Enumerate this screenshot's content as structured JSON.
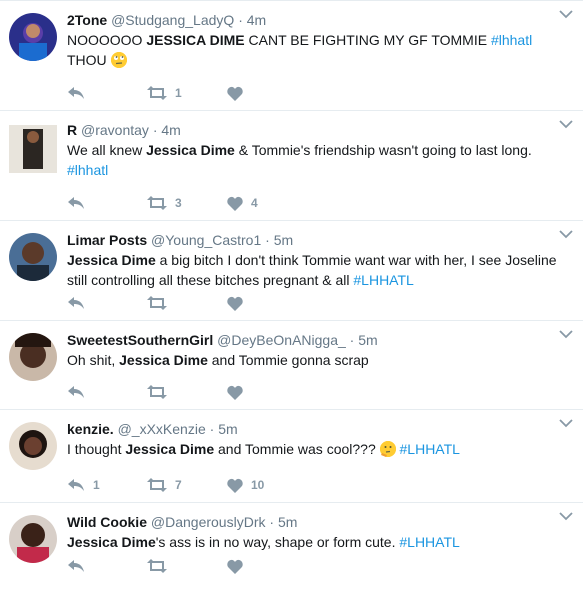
{
  "colors": {
    "link": "#1b95e0",
    "muted": "#657786",
    "action": "#8899a6",
    "divider": "#e6ecf0"
  },
  "icons": {
    "reply": "reply-icon",
    "retweet": "retweet-icon",
    "like": "heart-icon",
    "menu": "chevron-down-icon"
  },
  "tweets": [
    {
      "name": "2Tone",
      "handle": "@Studgang_LadyQ",
      "sep": "·",
      "time": "4m",
      "pre": "NOOOOOO ",
      "bold": "JESSICA DIME",
      "post": " CANT BE FIGHTING MY GF TOMMIE ",
      "tag": "#lhhatl",
      "line2": "THOU",
      "emoji": "rolling-eyes-emoji",
      "retweets": "1",
      "likes": "",
      "replies": ""
    },
    {
      "name": "R",
      "handle": "@ravontay",
      "sep": "·",
      "time": "4m",
      "pre": "We all knew ",
      "bold": "Jessica Dime",
      "post": " & Tommie's friendship wasn't going to last long.",
      "tag": "",
      "line2_tag": "#lhhatl",
      "retweets": "3",
      "likes": "4",
      "replies": ""
    },
    {
      "name": "Limar Posts",
      "handle": "@Young_Castro1",
      "sep": "·",
      "time": "5m",
      "pre": "",
      "bold": "Jessica Dime",
      "post": " a big bitch I don't think Tommie want war with her, I see Joseline still controlling all these bitches pregnant & all ",
      "tag": "#LHHATL",
      "retweets": "",
      "likes": "",
      "replies": ""
    },
    {
      "name": "SweetestSouthernGirl",
      "handle": "@DeyBeOnANigga_",
      "sep": "·",
      "time": "5m",
      "pre": "Oh shit, ",
      "bold": "Jessica Dime",
      "post": " and Tommie gonna scrap",
      "tag": "",
      "retweets": "",
      "likes": "",
      "replies": ""
    },
    {
      "name": "kenzie.",
      "handle": "@_xXxKenzie",
      "sep": "·",
      "time": "5m",
      "pre": "I thought ",
      "bold": "Jessica Dime",
      "post": " and Tommie was cool??? ",
      "tag": "#LHHATL",
      "emoji": "thinking-face-emoji",
      "retweets": "7",
      "likes": "10",
      "replies": "1"
    },
    {
      "name": "Wild Cookie",
      "handle": "@DangerouslyDrk",
      "sep": "·",
      "time": "5m",
      "pre": "",
      "bold": "Jessica Dime",
      "post": "'s ass is in no way, shape or form cute. ",
      "tag": "#LHHATL",
      "retweets": "",
      "likes": "",
      "replies": ""
    }
  ]
}
